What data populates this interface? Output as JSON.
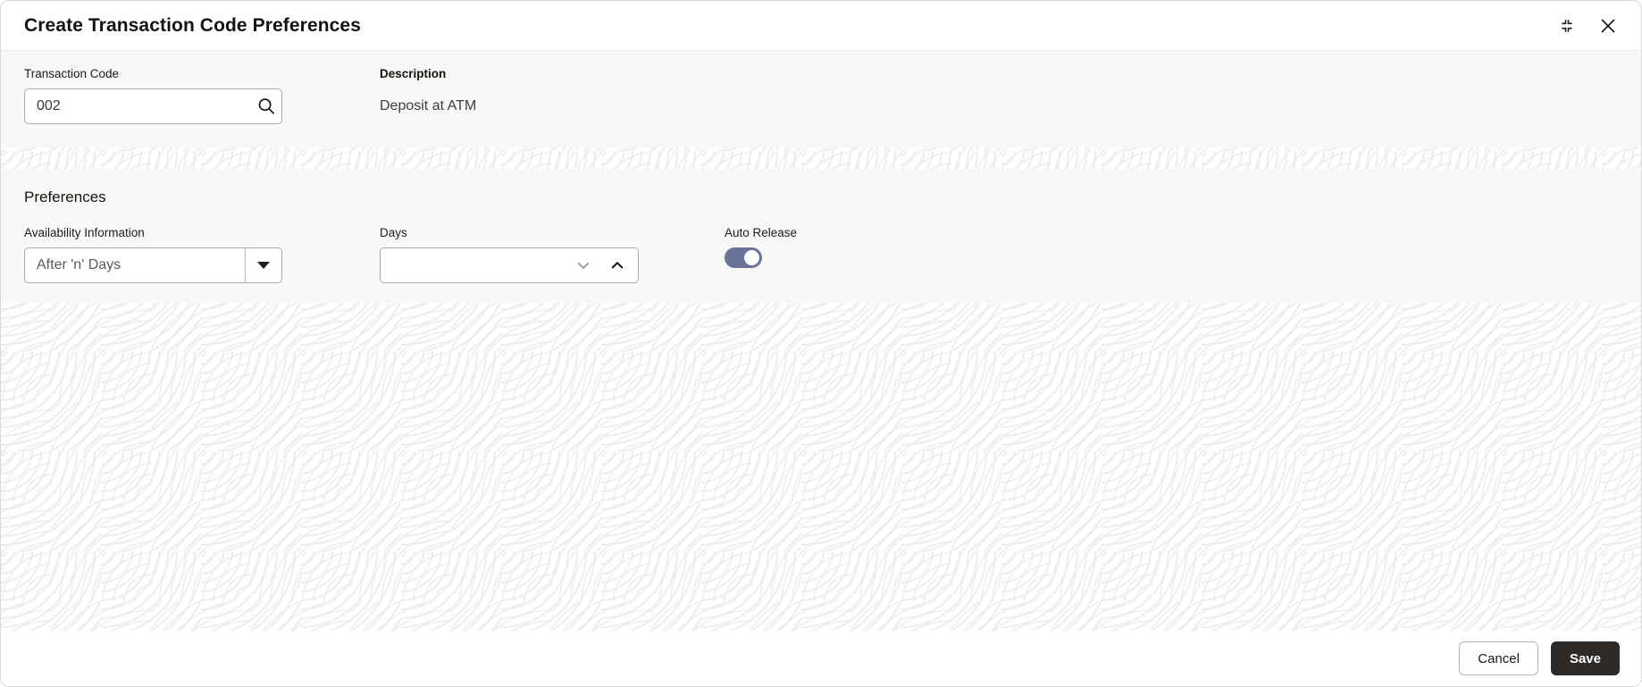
{
  "window": {
    "title": "Create Transaction Code Preferences",
    "minimize_icon": "collapse-corners-icon",
    "close_icon": "close-icon"
  },
  "top_section": {
    "transaction_code": {
      "label": "Transaction Code",
      "value": "002",
      "placeholder": "",
      "search_icon": "search-icon"
    },
    "description": {
      "label": "Description",
      "value": "Deposit at ATM"
    }
  },
  "preferences": {
    "section_title": "Preferences",
    "availability": {
      "label": "Availability Information",
      "value": "After 'n' Days",
      "caret_icon": "caret-down-icon",
      "options": [
        "After 'n' Days"
      ]
    },
    "days": {
      "label": "Days",
      "value": "",
      "placeholder": "",
      "decrement_icon": "chevron-down-icon",
      "increment_icon": "chevron-up-icon"
    },
    "auto_release": {
      "label": "Auto Release",
      "state": "on"
    }
  },
  "footer": {
    "cancel_label": "Cancel",
    "save_label": "Save"
  },
  "colors": {
    "toggle_on": "#69739a",
    "primary_button": "#2e2a27",
    "panel_background": "#f8f8f7"
  }
}
